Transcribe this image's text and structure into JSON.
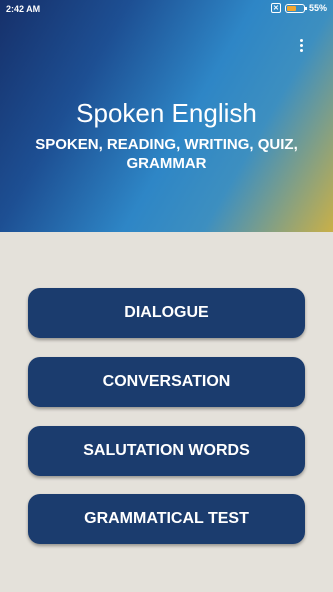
{
  "status_bar": {
    "time": "2:42 AM",
    "battery_percent": "55%",
    "battery_level": 0.55,
    "sim_icon": "x-box-icon"
  },
  "header": {
    "title": "Spoken English",
    "subtitle": "SPOKEN, READING, WRITING, QUIZ, GRAMMAR",
    "menu_icon": "overflow-menu-icon"
  },
  "menu": {
    "items": [
      {
        "label": "DIALOGUE"
      },
      {
        "label": "CONVERSATION"
      },
      {
        "label": "SALUTATION WORDS"
      },
      {
        "label": "GRAMMATICAL TEST"
      }
    ]
  },
  "colors": {
    "button_bg": "#1b3c6e",
    "page_bg": "#e4e1da",
    "battery_fill": "#f2a630"
  }
}
